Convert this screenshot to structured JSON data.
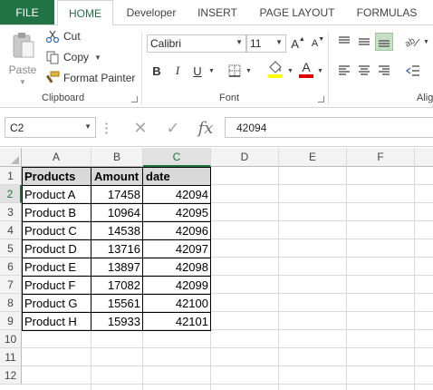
{
  "tabs": {
    "file": "FILE",
    "items": [
      "HOME",
      "Developer",
      "INSERT",
      "PAGE LAYOUT",
      "FORMULAS"
    ]
  },
  "ribbon": {
    "clipboard": {
      "label": "Clipboard",
      "paste": "Paste",
      "cut": "Cut",
      "copy": "Copy",
      "format_painter": "Format Painter"
    },
    "font": {
      "label": "Font",
      "font_name": "Calibri",
      "font_size": "11",
      "bold": "B",
      "italic": "I",
      "underline": "U",
      "grow": "A",
      "shrink": "A",
      "font_color_letter": "A"
    },
    "alignment": {
      "label": "Alig"
    }
  },
  "formula_bar": {
    "name_box": "C2",
    "fx": "fx",
    "value": "42094"
  },
  "sheet": {
    "columns": [
      "A",
      "B",
      "C",
      "D",
      "E",
      "F"
    ],
    "rows": [
      "1",
      "2",
      "3",
      "4",
      "5",
      "6",
      "7",
      "8",
      "9",
      "10",
      "11",
      "12"
    ],
    "selected_column": "C",
    "selected_row": "2",
    "header": [
      "Products",
      "Amount",
      "date"
    ],
    "data": [
      [
        "Product A",
        "17458",
        "42094"
      ],
      [
        "Product B",
        "10964",
        "42095"
      ],
      [
        "Product C",
        "14538",
        "42096"
      ],
      [
        "Product D",
        "13716",
        "42097"
      ],
      [
        "Product E",
        "13897",
        "42098"
      ],
      [
        "Product F",
        "17082",
        "42099"
      ],
      [
        "Product G",
        "15561",
        "42100"
      ],
      [
        "Product H",
        "15933",
        "42101"
      ]
    ]
  },
  "colors": {
    "accent": "#217346",
    "fill_yellow": "#ffff00",
    "font_red": "#e00000",
    "header_fill": "#d9d9d9"
  }
}
